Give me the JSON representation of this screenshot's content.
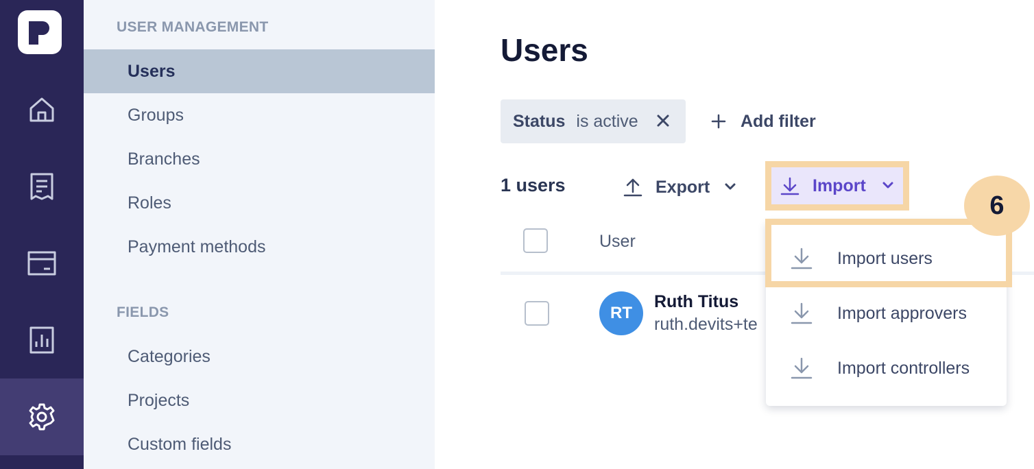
{
  "rail": {
    "logo_icon": "app-logo-icon",
    "items": [
      {
        "icon": "home-icon"
      },
      {
        "icon": "receipt-icon"
      },
      {
        "icon": "card-icon"
      },
      {
        "icon": "report-icon"
      },
      {
        "icon": "gear-icon",
        "active": true
      }
    ]
  },
  "sidebar": {
    "section1": "USER MANAGEMENT",
    "items1": [
      "Users",
      "Groups",
      "Branches",
      "Roles",
      "Payment methods"
    ],
    "section2": "FIELDS",
    "items2": [
      "Categories",
      "Projects",
      "Custom fields"
    ]
  },
  "main": {
    "title": "Users",
    "filter": {
      "key": "Status",
      "value": "is active"
    },
    "add_filter": "Add filter",
    "count": "1 users",
    "export": "Export",
    "import": "Import",
    "table": {
      "header_user": "User",
      "rows": [
        {
          "initials": "RT",
          "name": "Ruth Titus",
          "email": "ruth.devits+te"
        }
      ]
    }
  },
  "import_menu": {
    "items": [
      "Import users",
      "Import approvers",
      "Import controllers"
    ]
  },
  "step_badge": "6",
  "colors": {
    "rail": "#2a2657",
    "accent": "#5b46c9",
    "highlight": "#f6d6a6",
    "avatar": "#3f8fe4"
  }
}
